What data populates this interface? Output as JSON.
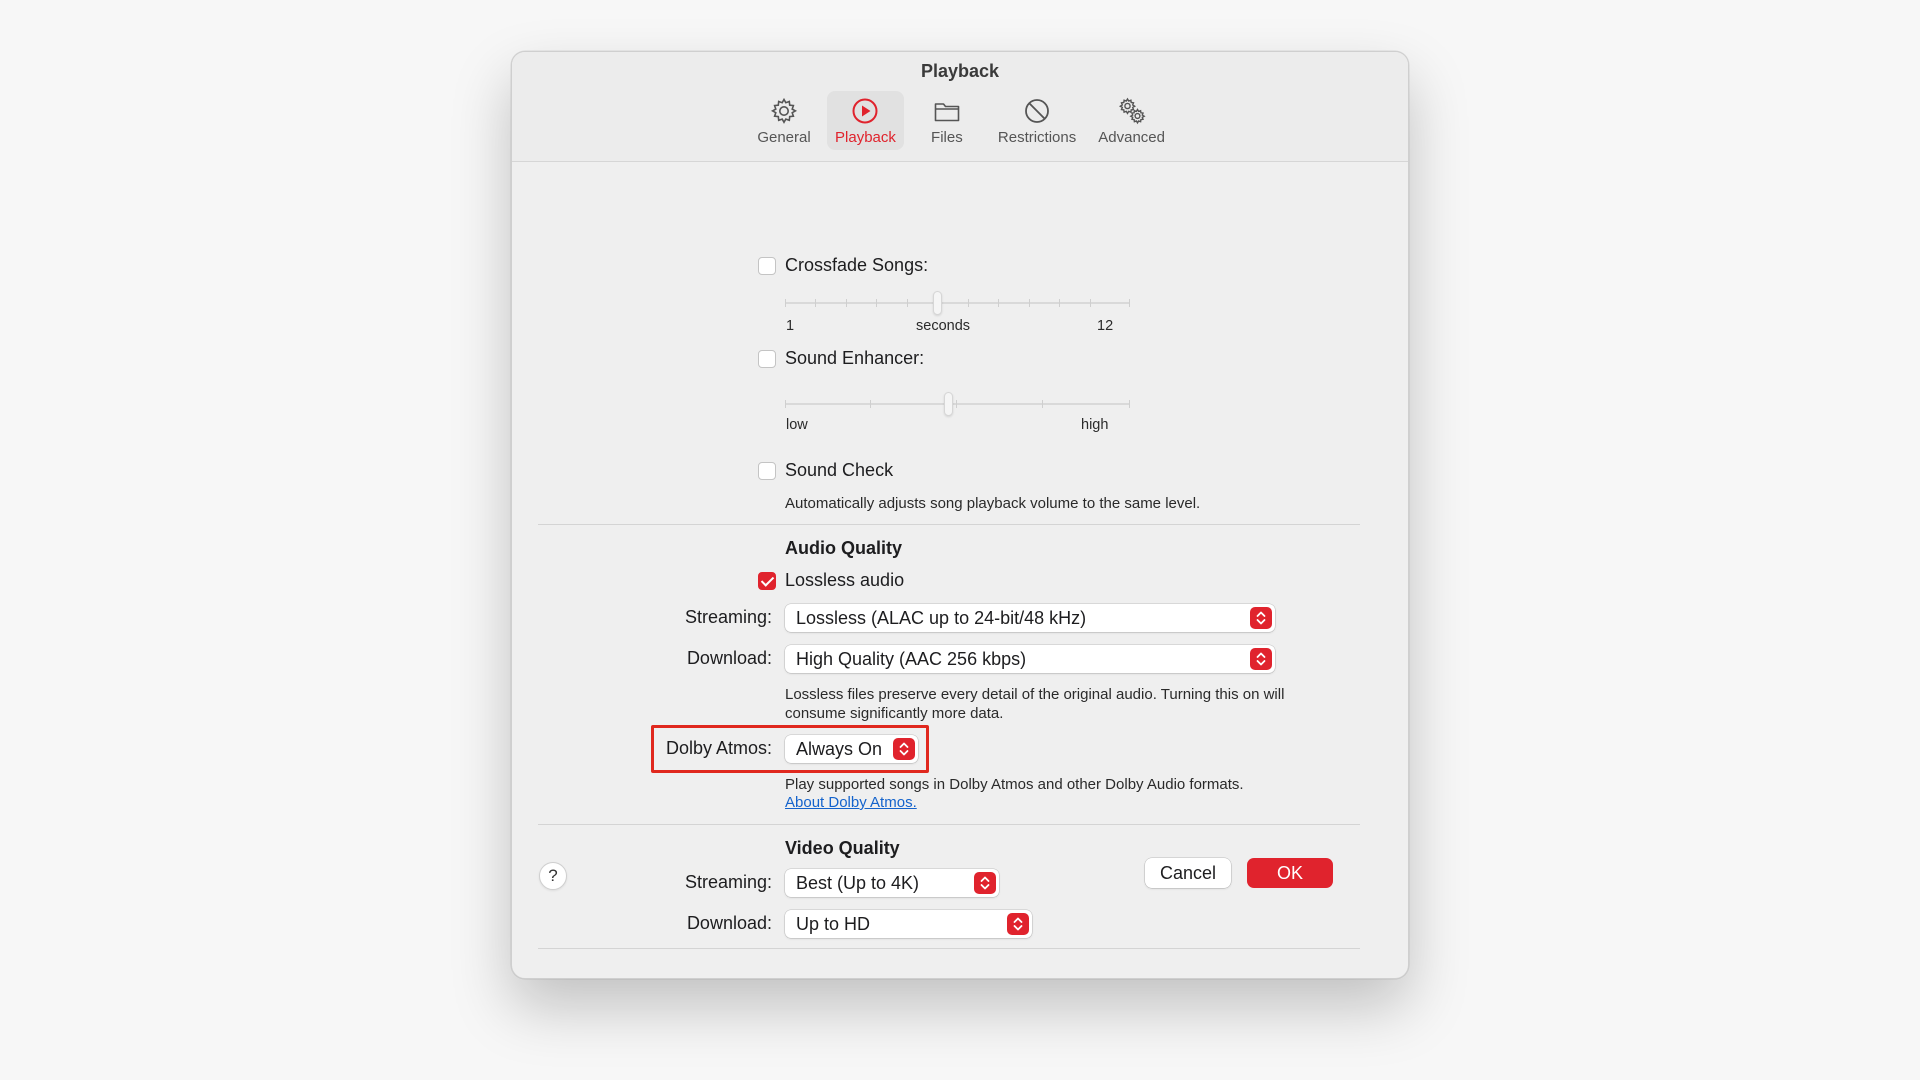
{
  "window": {
    "title": "Playback"
  },
  "toolbar": {
    "tabs": [
      {
        "label": "General",
        "icon": "gear-icon"
      },
      {
        "label": "Playback",
        "icon": "play-circle-icon",
        "active": true
      },
      {
        "label": "Files",
        "icon": "folder-icon"
      },
      {
        "label": "Restrictions",
        "icon": "restricted-icon"
      },
      {
        "label": "Advanced",
        "icon": "gears-icon"
      }
    ]
  },
  "crossfade": {
    "label": "Crossfade Songs:",
    "checked": false,
    "min_label": "1",
    "unit_label": "seconds",
    "max_label": "12"
  },
  "sound_enhancer": {
    "label": "Sound Enhancer:",
    "checked": false,
    "low_label": "low",
    "high_label": "high"
  },
  "sound_check": {
    "label": "Sound Check",
    "checked": false,
    "description": "Automatically adjusts song playback volume to the same level."
  },
  "audio_quality": {
    "heading": "Audio Quality",
    "lossless": {
      "label": "Lossless audio",
      "checked": true
    },
    "streaming": {
      "label": "Streaming:",
      "value": "Lossless (ALAC up to 24-bit/48 kHz)"
    },
    "download": {
      "label": "Download:",
      "value": "High Quality (AAC 256 kbps)"
    },
    "description": "Lossless files preserve every detail of the original audio. Turning this on will consume significantly more data.",
    "dolby": {
      "label": "Dolby Atmos:",
      "value": "Always On",
      "description": "Play supported songs in Dolby Atmos and other Dolby Audio formats.",
      "link": "About Dolby Atmos."
    }
  },
  "video_quality": {
    "heading": "Video Quality",
    "streaming": {
      "label": "Streaming:",
      "value": "Best (Up to 4K)"
    },
    "download": {
      "label": "Download:",
      "value": "Up to HD"
    }
  },
  "footer": {
    "help": "?",
    "cancel": "Cancel",
    "ok": "OK"
  },
  "colors": {
    "accent": "#e0232d",
    "highlight_border": "#e0281e",
    "link": "#1463cc"
  }
}
